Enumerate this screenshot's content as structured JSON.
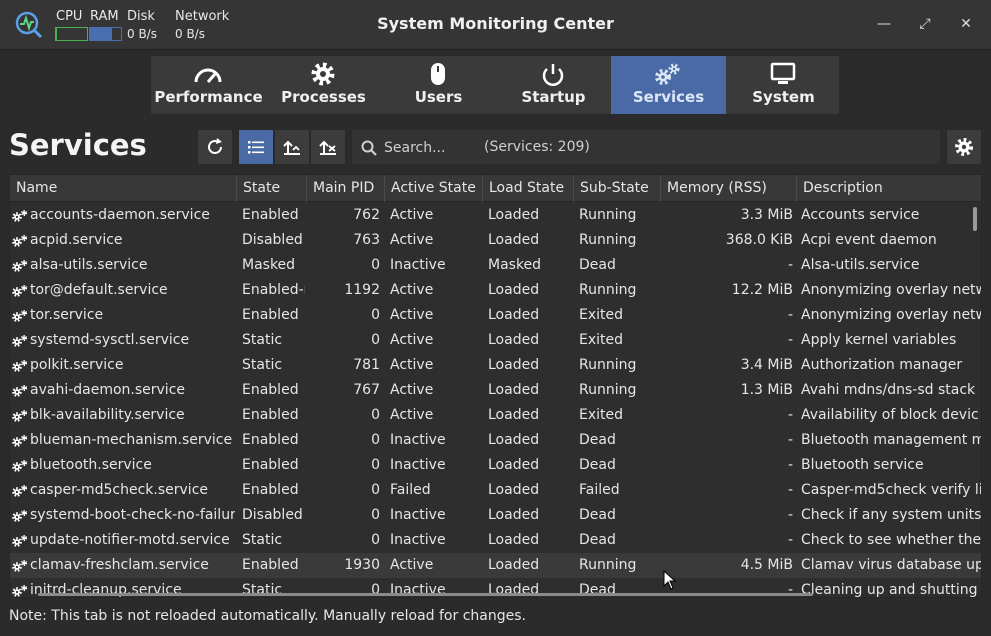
{
  "window": {
    "title": "System Monitoring Center",
    "minimize_glyph": "—",
    "maximize_glyph": "⤢",
    "close_glyph": "✕"
  },
  "mini_monitor": {
    "cpu_label": "CPU",
    "ram_label": "RAM",
    "disk_label": "Disk",
    "network_label": "Network",
    "disk_value": "0 B/s",
    "network_value": "0 B/s",
    "cpu_fill": 0.03,
    "ram_fill": 0.72,
    "cpu_color": "#4caf50",
    "ram_color": "#4a6fb0"
  },
  "tabs": [
    {
      "label": "Performance",
      "icon": "speedometer-icon",
      "active": false
    },
    {
      "label": "Processes",
      "icon": "gear-icon",
      "active": false
    },
    {
      "label": "Users",
      "icon": "mouse-icon",
      "active": false
    },
    {
      "label": "Startup",
      "icon": "power-icon",
      "active": false
    },
    {
      "label": "Services",
      "icon": "gears-icon",
      "active": true
    },
    {
      "label": "System",
      "icon": "monitor-icon",
      "active": false
    }
  ],
  "page": {
    "title": "Services",
    "search_placeholder": "Search...",
    "count_text": "(Services: 209)",
    "note": "Note: This tab is not reloaded automatically. Manually reload for changes."
  },
  "colors": {
    "accent": "#4a6aa5",
    "background": "#2b2b2b"
  },
  "table": {
    "columns": [
      "Name",
      "State",
      "Main PID",
      "Active State",
      "Load State",
      "Sub-State",
      "Memory (RSS)",
      "Description"
    ],
    "rows": [
      {
        "name": "accounts-daemon.service",
        "state": "Enabled",
        "pid": "762",
        "active": "Active",
        "load": "Loaded",
        "sub": "Running",
        "mem": "3.3 MiB",
        "desc": "Accounts service"
      },
      {
        "name": "acpid.service",
        "state": "Disabled",
        "pid": "763",
        "active": "Active",
        "load": "Loaded",
        "sub": "Running",
        "mem": "368.0 KiB",
        "desc": "Acpi event daemon"
      },
      {
        "name": "alsa-utils.service",
        "state": "Masked",
        "pid": "0",
        "active": "Inactive",
        "load": "Masked",
        "sub": "Dead",
        "mem": "-",
        "desc": "Alsa-utils.service"
      },
      {
        "name": "tor@default.service",
        "state": "Enabled-r",
        "pid": "1192",
        "active": "Active",
        "load": "Loaded",
        "sub": "Running",
        "mem": "12.2 MiB",
        "desc": "Anonymizing overlay netw"
      },
      {
        "name": "tor.service",
        "state": "Enabled",
        "pid": "0",
        "active": "Active",
        "load": "Loaded",
        "sub": "Exited",
        "mem": "-",
        "desc": "Anonymizing overlay netw"
      },
      {
        "name": "systemd-sysctl.service",
        "state": "Static",
        "pid": "0",
        "active": "Active",
        "load": "Loaded",
        "sub": "Exited",
        "mem": "-",
        "desc": "Apply kernel variables"
      },
      {
        "name": "polkit.service",
        "state": "Static",
        "pid": "781",
        "active": "Active",
        "load": "Loaded",
        "sub": "Running",
        "mem": "3.4 MiB",
        "desc": "Authorization manager"
      },
      {
        "name": "avahi-daemon.service",
        "state": "Enabled",
        "pid": "767",
        "active": "Active",
        "load": "Loaded",
        "sub": "Running",
        "mem": "1.3 MiB",
        "desc": "Avahi mdns/dns-sd stack"
      },
      {
        "name": "blk-availability.service",
        "state": "Enabled",
        "pid": "0",
        "active": "Active",
        "load": "Loaded",
        "sub": "Exited",
        "mem": "-",
        "desc": "Availability of block devic"
      },
      {
        "name": "blueman-mechanism.service",
        "state": "Enabled",
        "pid": "0",
        "active": "Inactive",
        "load": "Loaded",
        "sub": "Dead",
        "mem": "-",
        "desc": "Bluetooth management m"
      },
      {
        "name": "bluetooth.service",
        "state": "Enabled",
        "pid": "0",
        "active": "Inactive",
        "load": "Loaded",
        "sub": "Dead",
        "mem": "-",
        "desc": "Bluetooth service"
      },
      {
        "name": "casper-md5check.service",
        "state": "Enabled",
        "pid": "0",
        "active": "Failed",
        "load": "Loaded",
        "sub": "Failed",
        "mem": "-",
        "desc": "Casper-md5check verify li"
      },
      {
        "name": "systemd-boot-check-no-failur",
        "state": "Disabled",
        "pid": "0",
        "active": "Inactive",
        "load": "Loaded",
        "sub": "Dead",
        "mem": "-",
        "desc": "Check if any system units"
      },
      {
        "name": "update-notifier-motd.service",
        "state": "Static",
        "pid": "0",
        "active": "Inactive",
        "load": "Loaded",
        "sub": "Dead",
        "mem": "-",
        "desc": "Check to see whether ther"
      },
      {
        "name": "clamav-freshclam.service",
        "state": "Enabled",
        "pid": "1930",
        "active": "Active",
        "load": "Loaded",
        "sub": "Running",
        "mem": "4.5 MiB",
        "desc": "Clamav virus database up"
      },
      {
        "name": "initrd-cleanup.service",
        "state": "Static",
        "pid": "0",
        "active": "Inactive",
        "load": "Loaded",
        "sub": "Dead",
        "mem": "-",
        "desc": "Cleaning up and shutting"
      }
    ],
    "highlighted_row": 14
  }
}
